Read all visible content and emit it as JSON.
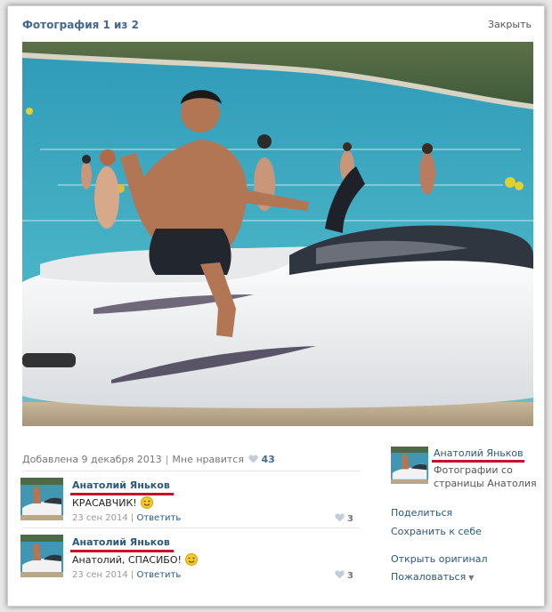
{
  "header": {
    "title": "Фотография 1 из 2",
    "close_label": "Закрыть"
  },
  "photo_info": {
    "added_label": "Добавлена 9 декабря 2013",
    "likes_label": "Мне нравится",
    "likes_count": "43"
  },
  "comments": [
    {
      "author": "Анатолий Яньков",
      "text": "КРАСАВЧИК!",
      "date": "23 сен 2014",
      "reply_label": "Ответить",
      "likes": "3"
    },
    {
      "author": "Анатолий Яньков",
      "text": "Анатолий, СПАСИБО!",
      "date": "23 сен 2014",
      "reply_label": "Ответить",
      "likes": "3"
    }
  ],
  "sidebar": {
    "author": "Анатолий Яньков",
    "description": "Фотографии со страницы Анатолия",
    "actions": {
      "share": "Поделиться",
      "save": "Сохранить к себе",
      "open_original": "Открыть оригинал",
      "report": "Пожаловаться"
    }
  },
  "colors": {
    "link": "#2b587a",
    "title": "#45688e",
    "highlight_underline": "#c8102e"
  }
}
